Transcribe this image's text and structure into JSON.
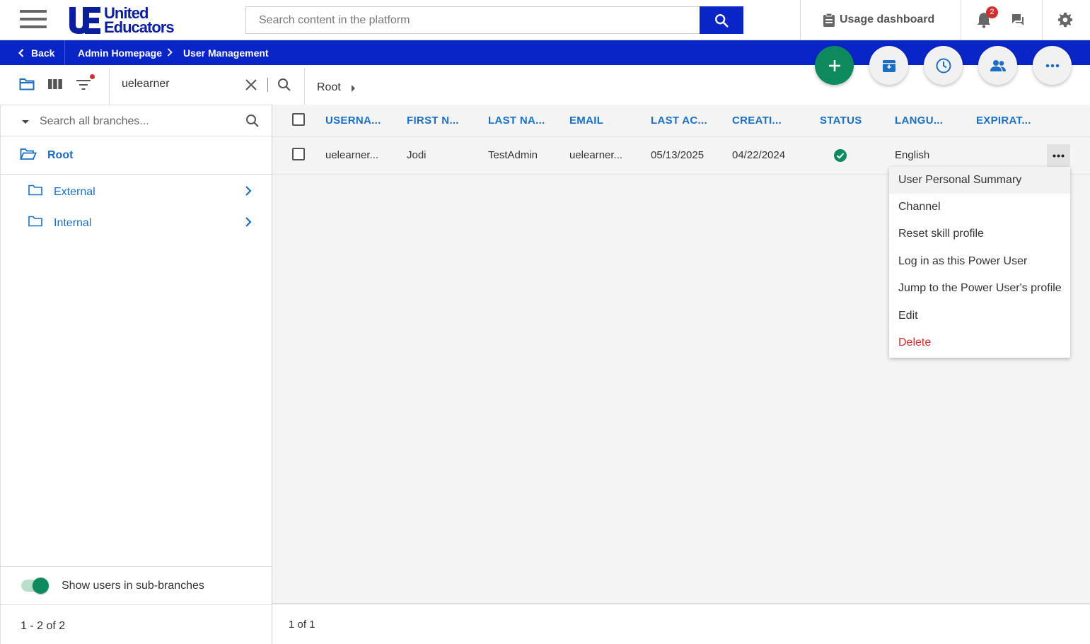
{
  "header": {
    "logo_line1": "United",
    "logo_line2": "Educators",
    "logo_mark": "UE",
    "search_placeholder": "Search content in the platform",
    "usage_label": "Usage dashboard",
    "notification_count": "2"
  },
  "breadcrumb": {
    "back_label": "Back",
    "items": [
      "Admin Homepage",
      "User Management"
    ]
  },
  "toolbar": {
    "user_search_value": "uelearner",
    "path_root": "Root"
  },
  "branches": {
    "search_placeholder": "Search all branches...",
    "root_label": "Root",
    "items": [
      {
        "label": "External"
      },
      {
        "label": "Internal"
      }
    ],
    "sub_branches_label": "Show users in sub-branches",
    "sub_branches_on": true,
    "pagination": "1 - 2 of 2"
  },
  "grid": {
    "columns": [
      "USERNA...",
      "FIRST N...",
      "LAST NA...",
      "EMAIL",
      "LAST AC...",
      "CREATI...",
      "STATUS",
      "LANGU...",
      "EXPIRAT..."
    ],
    "rows": [
      {
        "username": "uelearner...",
        "first_name": "Jodi",
        "last_name": "TestAdmin",
        "email": "uelearner...",
        "last_access": "05/13/2025",
        "creation": "04/22/2024",
        "status": "active",
        "language": "English",
        "expiration": ""
      }
    ],
    "pagination": "1 of 1"
  },
  "context_menu": {
    "items": [
      "User Personal Summary",
      "Channel",
      "Reset skill profile",
      "Log in as this Power User",
      "Jump to the Power User's profile",
      "Edit",
      "Delete"
    ]
  },
  "colors": {
    "brand_blue": "#0a25c6",
    "link_blue": "#1a6fc4",
    "green": "#0e8a5f",
    "danger": "#d32f2f"
  }
}
